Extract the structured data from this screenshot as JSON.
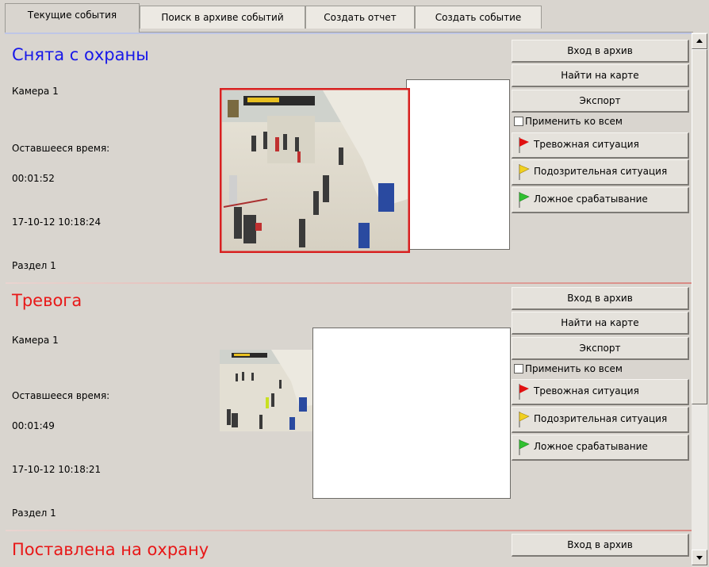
{
  "tabs": [
    "Текущие события",
    "Поиск в архиве событий",
    "Создать отчет",
    "Создать событие"
  ],
  "events": [
    {
      "title": "Снята с охраны",
      "title_color": "#1818e8",
      "camera": "Камера 1",
      "remaining_label": "Оставшееся время:",
      "remaining": "00:01:52",
      "timestamp": "17-10-12 10:18:24",
      "section": "Раздел 1"
    },
    {
      "title": "Тревога",
      "title_color": "#e81818",
      "camera": "Камера 1",
      "remaining_label": "Оставшееся время:",
      "remaining": "00:01:49",
      "timestamp": "17-10-12 10:18:21",
      "section": "Раздел 1"
    },
    {
      "title": "Поставлена на охрану",
      "title_color": "#e81818"
    }
  ],
  "actions": {
    "archive": "Вход в архив",
    "map": "Найти на карте",
    "export": "Экспорт",
    "apply_all": "Применить ко всем",
    "alarm": "Тревожная ситуация",
    "suspicious": "Подозрительная ситуация",
    "false_alarm": "Ложное срабатывание"
  },
  "colors": {
    "flag_alarm": "#e01010",
    "flag_suspicious": "#f0d020",
    "flag_false": "#30c030",
    "thumb_border": "#d82020"
  }
}
